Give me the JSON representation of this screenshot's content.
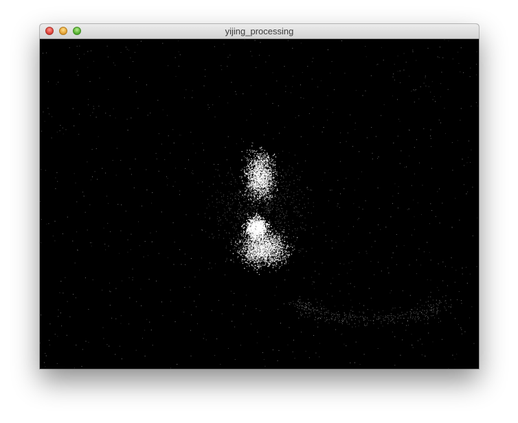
{
  "window": {
    "title": "yijing_processing"
  },
  "traffic_lights": {
    "close_color": "#e0463c",
    "minimize_color": "#e6a53a",
    "zoom_color": "#5ab534"
  },
  "sketch": {
    "background": "#000000",
    "particle_color": "#ffffff"
  }
}
